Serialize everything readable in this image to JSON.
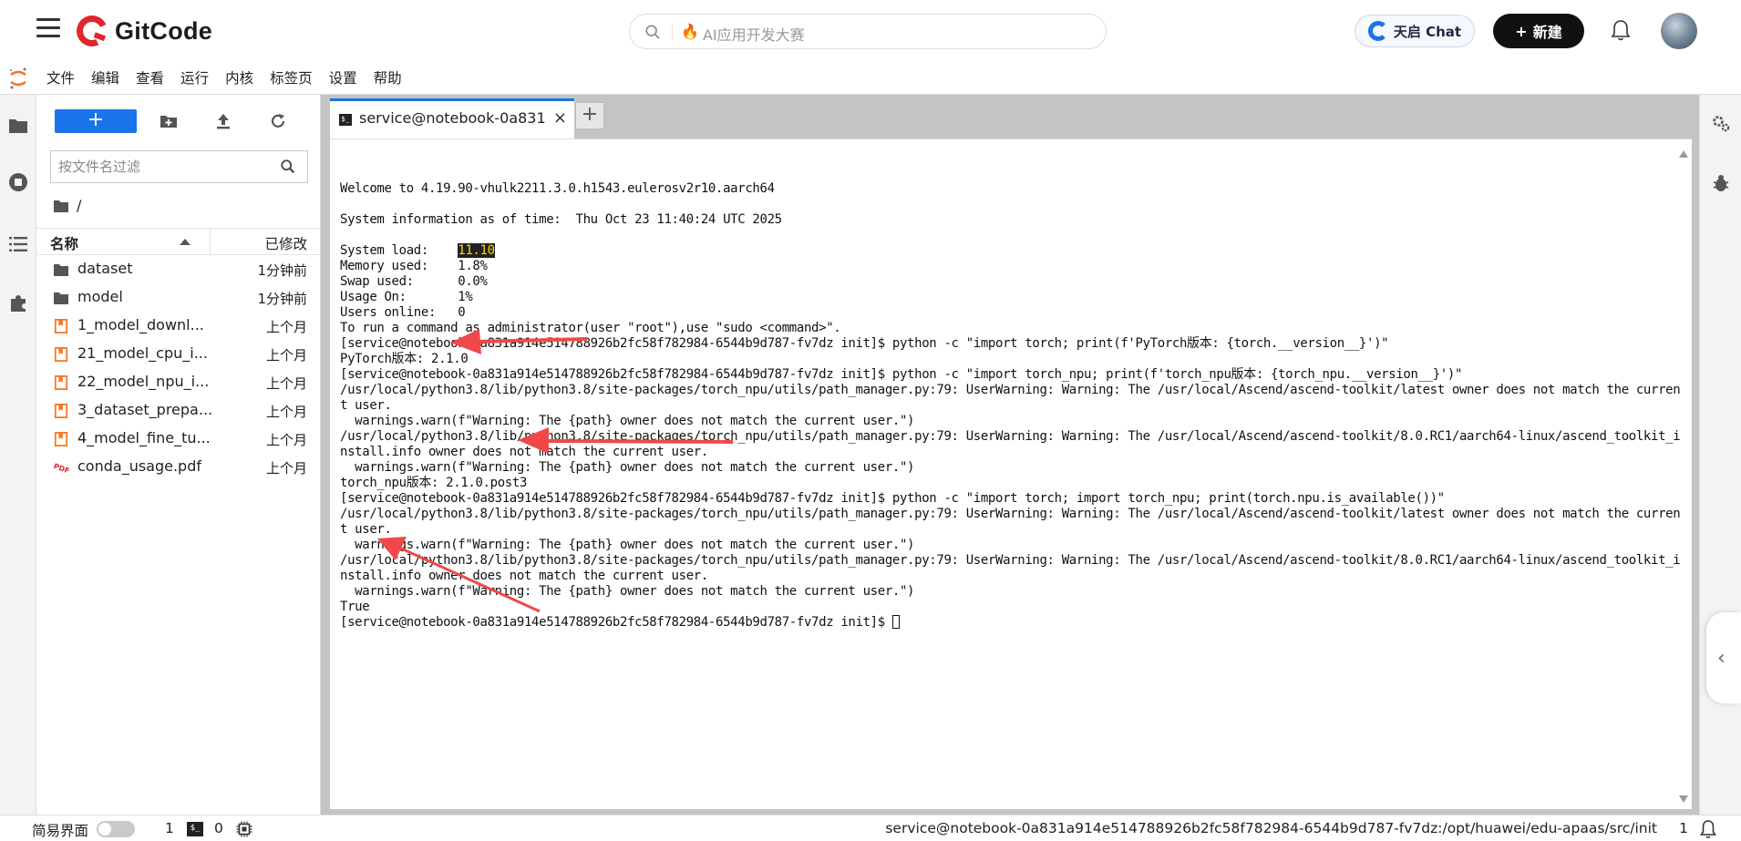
{
  "header": {
    "logo_text": "GitCode",
    "search_placeholder": "AI应用开发大赛",
    "chat_button": "天启 Chat",
    "new_button": "新建"
  },
  "menu": {
    "items": [
      "文件",
      "编辑",
      "查看",
      "运行",
      "内核",
      "标签页",
      "设置",
      "帮助"
    ]
  },
  "filebrowser": {
    "new_label": "+",
    "filter_placeholder": "按文件名过滤",
    "breadcrumb": "/",
    "col_name": "名称",
    "col_modified": "已修改",
    "files": [
      {
        "name": "dataset",
        "type": "folder",
        "modified": "1分钟前"
      },
      {
        "name": "model",
        "type": "folder",
        "modified": "1分钟前"
      },
      {
        "name": "1_model_downl...",
        "type": "notebook",
        "modified": "上个月"
      },
      {
        "name": "21_model_cpu_i...",
        "type": "notebook",
        "modified": "上个月"
      },
      {
        "name": "22_model_npu_i...",
        "type": "notebook",
        "modified": "上个月"
      },
      {
        "name": "3_dataset_prepa...",
        "type": "notebook",
        "modified": "上个月"
      },
      {
        "name": "4_model_fine_tu...",
        "type": "notebook",
        "modified": "上个月"
      },
      {
        "name": "conda_usage.pdf",
        "type": "pdf",
        "modified": "上个月"
      }
    ]
  },
  "tab": {
    "label": "service@notebook-0a831a",
    "close": "×",
    "add": "+",
    "icon_text": "$_"
  },
  "terminal": {
    "line_welcome": "Welcome to 4.19.90-vhulk2211.3.0.h1543.eulerosv2r10.aarch64",
    "line_sysinfo": "System information as of time:  Thu Oct 23 11:40:24 UTC 2025",
    "load_label": "System load:    ",
    "load_value": "11.10",
    "line_memory": "Memory used:    1.8%",
    "line_swap": "Swap used:      0.0%",
    "line_usage": "Usage On:       1%",
    "line_users": "Users online:   0",
    "line_root": "To run a command as administrator(user \"root\"),use \"sudo <command>\".",
    "cmd1": "[service@notebook-0a831a914e514788926b2fc58f782984-6544b9d787-fv7dz init]$ python -c \"import torch; print(f'PyTorch版本: {torch.__version__}')\"",
    "out1": "PyTorch版本: 2.1.0",
    "cmd2": "[service@notebook-0a831a914e514788926b2fc58f782984-6544b9d787-fv7dz init]$ python -c \"import torch_npu; print(f'torch_npu版本: {torch_npu.__version__}')\"",
    "warn1a": "/usr/local/python3.8/lib/python3.8/site-packages/torch_npu/utils/path_manager.py:79: UserWarning: Warning: The /usr/local/Ascend/ascend-toolkit/latest owner does not match the curren",
    "warn1b": "t user.",
    "warn1c": "  warnings.warn(f\"Warning: The {path} owner does not match the current user.\")",
    "warn2a": "/usr/local/python3.8/lib/python3.8/site-packages/torch_npu/utils/path_manager.py:79: UserWarning: Warning: The /usr/local/Ascend/ascend-toolkit/8.0.RC1/aarch64-linux/ascend_toolkit_i",
    "warn2b": "nstall.info owner does not match the current user.",
    "warn2c": "  warnings.warn(f\"Warning: The {path} owner does not match the current user.\")",
    "out2": "torch_npu版本: 2.1.0.post3",
    "cmd3": "[service@notebook-0a831a914e514788926b2fc58f782984-6544b9d787-fv7dz init]$ python -c \"import torch; import torch_npu; print(torch.npu.is_available())\"",
    "warn3a": "/usr/local/python3.8/lib/python3.8/site-packages/torch_npu/utils/path_manager.py:79: UserWarning: Warning: The /usr/local/Ascend/ascend-toolkit/latest owner does not match the curren",
    "warn3b": "t user.",
    "warn3c": "  warnings.warn(f\"Warning: The {path} owner does not match the current user.\")",
    "warn4a": "/usr/local/python3.8/lib/python3.8/site-packages/torch_npu/utils/path_manager.py:79: UserWarning: Warning: The /usr/local/Ascend/ascend-toolkit/8.0.RC1/aarch64-linux/ascend_toolkit_i",
    "warn4b": "nstall.info owner does not match the current user.",
    "warn4c": "  warnings.warn(f\"Warning: The {path} owner does not match the current user.\")",
    "out3": "True",
    "prompt": "[service@notebook-0a831a914e514788926b2fc58f782984-6544b9d787-fv7dz init]$ "
  },
  "statusbar": {
    "simple_mode": "简易界面",
    "count_a": "1",
    "count_b": "0",
    "path": "service@notebook-0a831a914e514788926b2fc58f782984-6544b9d787-fv7dz:/opt/huawei/edu-apaas/src/init",
    "count_c": "1"
  },
  "colors": {
    "accent": "#1a73e8",
    "annotation_arrow": "#f04848",
    "load_highlight": "#f5d90a",
    "brand_red": "#e0262d"
  }
}
